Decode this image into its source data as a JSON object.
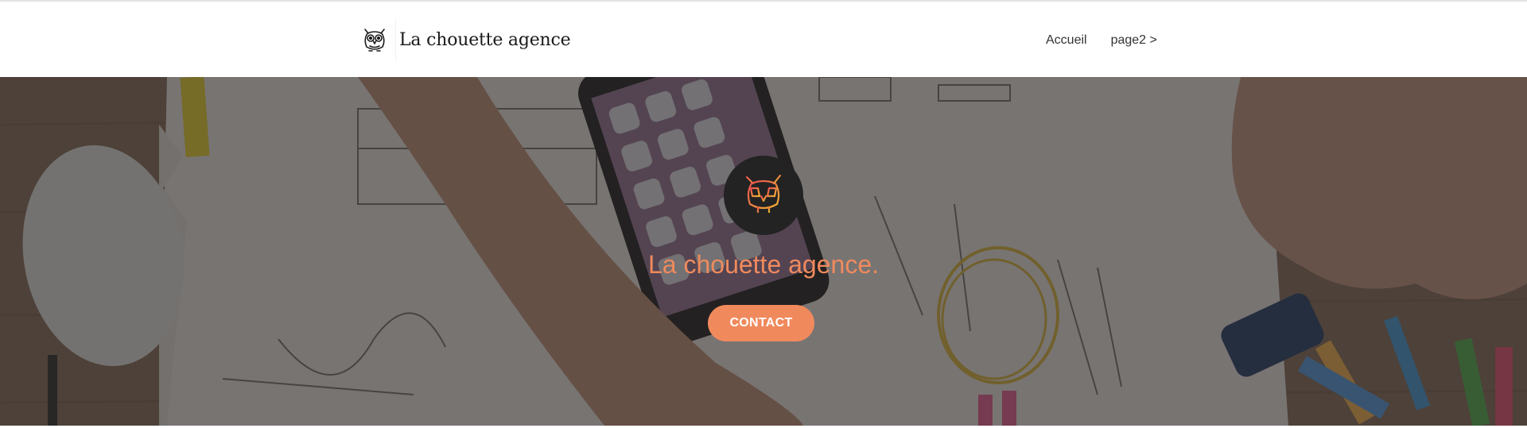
{
  "navbar": {
    "brand_name": "La chouette agence",
    "links": [
      {
        "label": "Accueil"
      },
      {
        "label": "page2 >"
      }
    ]
  },
  "hero": {
    "title": "La chouette agence.",
    "cta_label": "CONTACT",
    "logo_icon": "owl-icon"
  },
  "colors": {
    "accent": "#f08a5d",
    "logo_circle": "#232323",
    "nav_text": "#333333",
    "brand_text": "#1a1a1a"
  }
}
